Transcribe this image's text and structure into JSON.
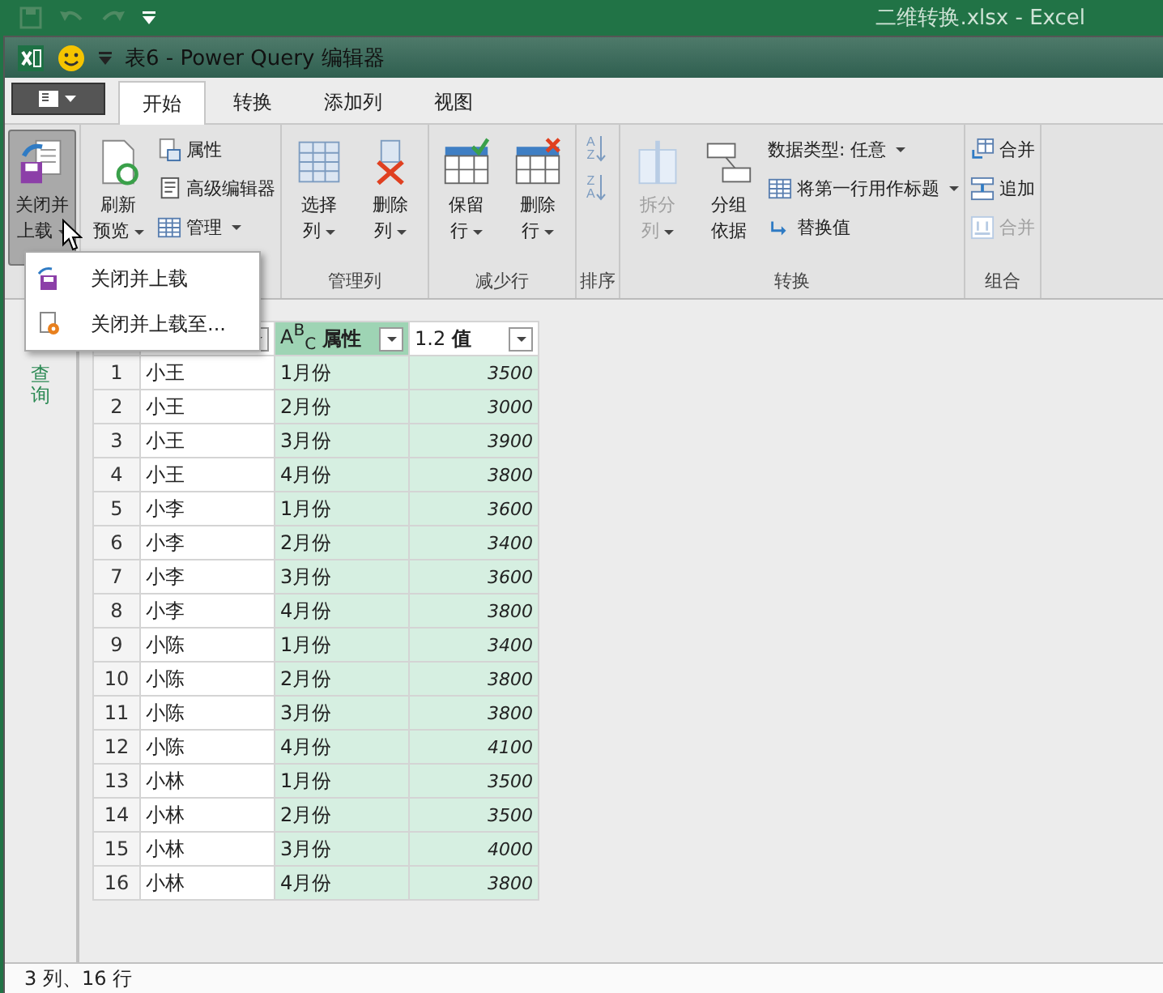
{
  "excel_title": "二维转换.xlsx  -  Excel",
  "window": {
    "title": "表6 - Power Query 编辑器"
  },
  "tabs": [
    {
      "label": "开始",
      "selected": true
    },
    {
      "label": "转换",
      "selected": false
    },
    {
      "label": "添加列",
      "selected": false
    },
    {
      "label": "视图",
      "selected": false
    }
  ],
  "ribbon": {
    "groups": [
      {
        "items": [
          {
            "kind": "large",
            "lines": [
              "关闭并",
              "上载"
            ],
            "dropdown": true,
            "pressed": true,
            "disabled": false
          }
        ]
      },
      {
        "items": [
          {
            "kind": "large",
            "lines": [
              "刷新",
              "预览"
            ],
            "dropdown": true,
            "pressed": false,
            "disabled": false
          },
          {
            "kind": "stack",
            "entries": [
              {
                "label": "属性",
                "dropdown": false,
                "disabled": false
              },
              {
                "label": "高级编辑器",
                "dropdown": false,
                "disabled": false
              },
              {
                "label": "管理",
                "dropdown": true,
                "disabled": false
              }
            ]
          }
        ]
      },
      {
        "label": "管理列",
        "items": [
          {
            "kind": "large",
            "lines": [
              "选择",
              "列"
            ],
            "dropdown": true,
            "pressed": false,
            "disabled": false
          },
          {
            "kind": "large",
            "lines": [
              "删除",
              "列"
            ],
            "dropdown": true,
            "pressed": false,
            "disabled": false
          }
        ]
      },
      {
        "label": "减少行",
        "items": [
          {
            "kind": "large",
            "lines": [
              "保留",
              "行"
            ],
            "dropdown": true,
            "pressed": false,
            "disabled": false
          },
          {
            "kind": "large",
            "lines": [
              "删除",
              "行"
            ],
            "dropdown": true,
            "pressed": false,
            "disabled": false
          }
        ]
      },
      {
        "label": "排序",
        "items": [
          {
            "kind": "sort",
            "buttons": [
              {
                "letters": [
                  "A",
                  "Z"
                ]
              },
              {
                "letters": [
                  "Z",
                  "A"
                ]
              }
            ]
          }
        ]
      },
      {
        "label": "转换",
        "items": [
          {
            "kind": "large",
            "lines": [
              "拆分",
              "列"
            ],
            "dropdown": true,
            "pressed": false,
            "disabled": true
          },
          {
            "kind": "large",
            "lines": [
              "分组",
              "依据"
            ],
            "dropdown": false,
            "pressed": false,
            "disabled": false
          },
          {
            "kind": "stack",
            "entries": [
              {
                "label": "数据类型: 任意",
                "dropdown": true,
                "disabled": false
              },
              {
                "label": "将第一行用作标题",
                "dropdown": true,
                "disabled": false
              },
              {
                "label": "替换值",
                "dropdown": false,
                "disabled": false
              }
            ]
          }
        ]
      },
      {
        "label": "组合",
        "items": [
          {
            "kind": "stack",
            "entries": [
              {
                "label": "合并",
                "dropdown": false,
                "disabled": false
              },
              {
                "label": "追加",
                "dropdown": false,
                "disabled": false
              },
              {
                "label": "合并",
                "dropdown": false,
                "disabled": true
              }
            ]
          }
        ]
      }
    ]
  },
  "menu": {
    "items": [
      {
        "label": "关闭并上载"
      },
      {
        "label": "关闭并上载至..."
      }
    ]
  },
  "sidebar": {
    "label": "查询"
  },
  "table": {
    "columns": [
      {},
      {},
      {
        "type": "A$^{B}$$_{C}$",
        "name": "属性"
      },
      {
        "type": "1.2",
        "name": "值"
      }
    ],
    "rows": [
      [
        "1",
        "小王",
        "1月份",
        "3500"
      ],
      [
        "2",
        "小王",
        "2月份",
        "3000"
      ],
      [
        "3",
        "小王",
        "3月份",
        "3900"
      ],
      [
        "4",
        "小王",
        "4月份",
        "3800"
      ],
      [
        "5",
        "小李",
        "1月份",
        "3600"
      ],
      [
        "6",
        "小李",
        "2月份",
        "3400"
      ],
      [
        "7",
        "小李",
        "3月份",
        "3600"
      ],
      [
        "8",
        "小李",
        "4月份",
        "3800"
      ],
      [
        "9",
        "小陈",
        "1月份",
        "3400"
      ],
      [
        "10",
        "小陈",
        "2月份",
        "3800"
      ],
      [
        "11",
        "小陈",
        "3月份",
        "3800"
      ],
      [
        "12",
        "小陈",
        "4月份",
        "4100"
      ],
      [
        "13",
        "小林",
        "1月份",
        "3500"
      ],
      [
        "14",
        "小林",
        "2月份",
        "3500"
      ],
      [
        "15",
        "小林",
        "3月份",
        "4000"
      ],
      [
        "16",
        "小林",
        "4月份",
        "3800"
      ]
    ]
  },
  "status_bar": "3 列、16 行"
}
